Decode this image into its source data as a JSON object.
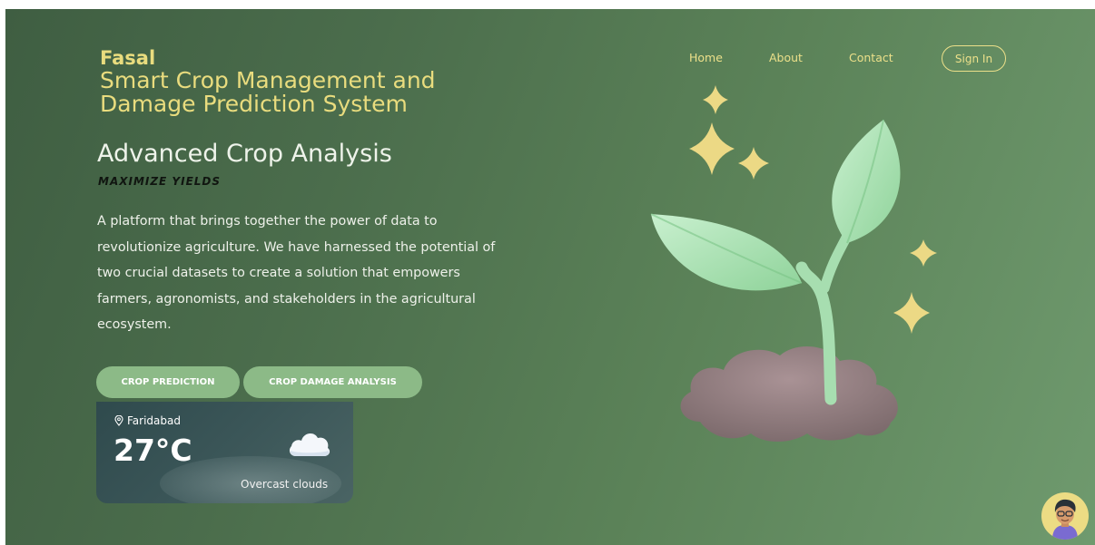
{
  "brand": {
    "name": "Fasal",
    "tagline": "Smart Crop Management and Damage Prediction System"
  },
  "nav": {
    "home": "Home",
    "about": "About",
    "contact": "Contact",
    "signin": "Sign In"
  },
  "hero": {
    "headline": "Advanced Crop Analysis",
    "subhead": "MAXIMIZE YIELDS",
    "description": "A platform that brings together the power of data to revolutionize agriculture. We have harnessed the potential of two crucial datasets to create a solution that empowers farmers, agronomists, and stakeholders in the agricultural ecosystem."
  },
  "buttons": {
    "crop_prediction": "CROP PREDICTION",
    "crop_damage": "CROP DAMAGE ANALYSIS"
  },
  "weather": {
    "location": "Faridabad",
    "temperature": "27°C",
    "condition": "Overcast clouds",
    "icon": "cloud-icon"
  },
  "colors": {
    "brand_yellow": "#e9dc7e",
    "button_green": "#8cba87",
    "background_green": "#4b6d4c"
  }
}
